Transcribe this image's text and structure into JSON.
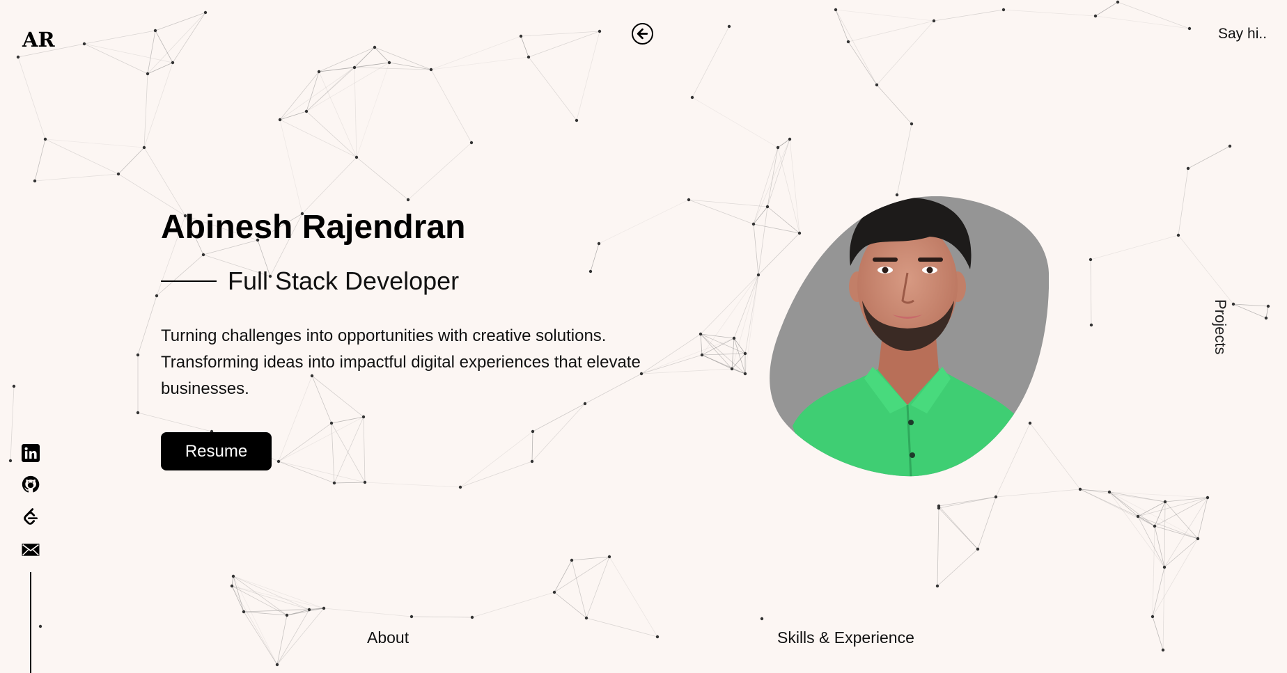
{
  "header": {
    "logo": "AR",
    "say_hi": "Say hi.."
  },
  "nav": {
    "projects": "Projects",
    "about": "About",
    "skills": "Skills & Experience"
  },
  "hero": {
    "name": "Abinesh Rajendran",
    "role": "Full Stack Developer",
    "description": "Turning challenges into opportunities with creative solutions. Transforming ideas into impactful digital experiences that elevate businesses.",
    "resume_label": "Resume"
  },
  "social": [
    "linkedin-icon",
    "github-icon",
    "leetcode-icon",
    "mail-icon"
  ],
  "colors": {
    "background": "#fcf6f3",
    "photo_bg": "#959595",
    "shirt": "#3fce73",
    "text": "#000000"
  }
}
